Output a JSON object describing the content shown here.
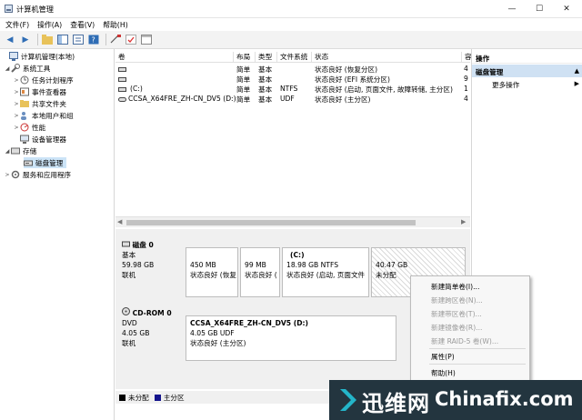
{
  "window": {
    "title": "计算机管理",
    "min": "—",
    "max": "☐",
    "close": "✕"
  },
  "menu": [
    "文件(F)",
    "操作(A)",
    "查看(V)",
    "帮助(H)"
  ],
  "tree": {
    "root": "计算机管理(本地)",
    "system_tools": "系统工具",
    "items": [
      "任务计划程序",
      "事件查看器",
      "共享文件夹",
      "本地用户和组",
      "性能",
      "设备管理器"
    ],
    "storage": "存储",
    "disk_mgmt": "磁盘管理",
    "services": "服务和应用程序"
  },
  "volumes": {
    "headers": [
      "卷",
      "布局",
      "类型",
      "文件系统",
      "状态",
      "容"
    ],
    "rows": [
      {
        "name": "",
        "layout": "简单",
        "type": "基本",
        "fs": "",
        "status": "状态良好 (恢复分区)",
        "cap": "4"
      },
      {
        "name": "",
        "layout": "简单",
        "type": "基本",
        "fs": "",
        "status": "状态良好 (EFI 系统分区)",
        "cap": "9"
      },
      {
        "name": "(C:)",
        "layout": "简单",
        "type": "基本",
        "fs": "NTFS",
        "status": "状态良好 (启动, 页面文件, 故障转储, 主分区)",
        "cap": "1"
      },
      {
        "name": "CCSA_X64FRE_ZH-CN_DV5 (D:)",
        "layout": "简单",
        "type": "基本",
        "fs": "UDF",
        "status": "状态良好 (主分区)",
        "cap": "4"
      }
    ]
  },
  "disks": {
    "disk0": {
      "name": "磁盘 0",
      "kind": "基本",
      "size": "59.98 GB",
      "state": "联机",
      "parts": [
        {
          "title": "",
          "size": "450 MB",
          "status": "状态良好 (恢复"
        },
        {
          "title": "",
          "size": "99 MB",
          "status": "状态良好 ("
        },
        {
          "title": "(C:)",
          "size": "18.98 GB NTFS",
          "status": "状态良好 (启动, 页面文件"
        },
        {
          "title": "",
          "size": "40.47 GB",
          "status": "未分配"
        }
      ]
    },
    "cdrom0": {
      "name": "CD-ROM 0",
      "kind": "DVD",
      "size": "4.05 GB",
      "state": "联机",
      "part": {
        "title": "CCSA_X64FRE_ZH-CN_DV5 (D:)",
        "size": "4.05 GB UDF",
        "status": "状态良好 (主分区)"
      }
    }
  },
  "legend": {
    "unalloc": "未分配",
    "primary": "主分区"
  },
  "actions": {
    "header": "操作",
    "section": "磁盘管理",
    "more": "更多操作"
  },
  "context_menu": {
    "new_simple": "新建简单卷(I)...",
    "new_spanned": "新建跨区卷(N)...",
    "new_striped": "新建带区卷(T)...",
    "new_mirror": "新建镜像卷(R)...",
    "new_raid5": "新建 RAID-5 卷(W)...",
    "properties": "属性(P)",
    "help": "帮助(H)"
  },
  "watermark": {
    "cn": "迅维网",
    "en": "Chinafix.com"
  },
  "colors": {
    "primary": "#14148c",
    "unallocated": "#000000",
    "selection": "#cce4f7"
  }
}
